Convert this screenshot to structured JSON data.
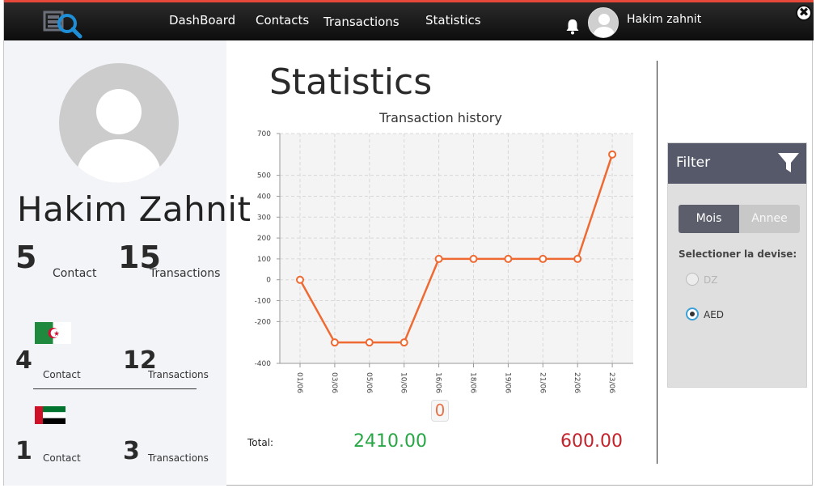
{
  "nav": {
    "items": [
      "DashBoard",
      "Contacts",
      "Transactions",
      "Statistics"
    ],
    "user_name": "Hakim zahnit",
    "close_symbol": "✖"
  },
  "icons": {
    "logo": "search-logo-icon",
    "bell": "bell-icon",
    "user": "user-avatar-icon",
    "close": "close-icon",
    "filter": "funnel-icon",
    "flag_dz": "algeria-flag-icon",
    "flag_ae": "uae-flag-icon"
  },
  "profile": {
    "name": "Hakim Zahnit",
    "total_contacts": "5",
    "total_contacts_label": "Contact",
    "total_transactions": "15",
    "total_transactions_label": "Transactions"
  },
  "countries": [
    {
      "flag": "algeria-flag-icon",
      "contacts": "4",
      "contacts_label": "Contact",
      "transactions": "12",
      "transactions_label": "Transactions"
    },
    {
      "flag": "uae-flag-icon",
      "contacts": "1",
      "contacts_label": "Contact",
      "transactions": "3",
      "transactions_label": "Transactions"
    }
  ],
  "main": {
    "title": "Statistics",
    "zero_badge": "0",
    "total_label": "Total:",
    "total_green": "2410.00",
    "total_red": "600.00"
  },
  "filter": {
    "title": "Filter",
    "seg_month": "Mois",
    "seg_year": "Annee",
    "select_label": "Selectioner la devise:",
    "options": [
      {
        "label": "DZ",
        "selected": false,
        "disabled": true
      },
      {
        "label": "AED",
        "selected": true,
        "disabled": false
      }
    ]
  },
  "colors": {
    "accent_line": "#ee6a32",
    "topbar": "#141414",
    "filter_head": "#56596a",
    "total_green": "#27a745",
    "total_red": "#c4222b"
  },
  "chart_data": {
    "type": "line",
    "title": "Transaction history",
    "xlabel": "",
    "ylabel": "",
    "categories": [
      "01/06",
      "03/06",
      "05/06",
      "10/06",
      "16/06",
      "18/06",
      "19/06",
      "21/06",
      "22/06",
      "23/06"
    ],
    "series": [
      {
        "values": [
          0,
          -300,
          -300,
          -300,
          100,
          100,
          100,
          100,
          100,
          600
        ]
      }
    ],
    "yticks": [
      -400,
      -200,
      -100,
      0,
      100,
      200,
      300,
      400,
      500,
      700
    ],
    "ylim": [
      -400,
      700
    ],
    "grid": true
  }
}
